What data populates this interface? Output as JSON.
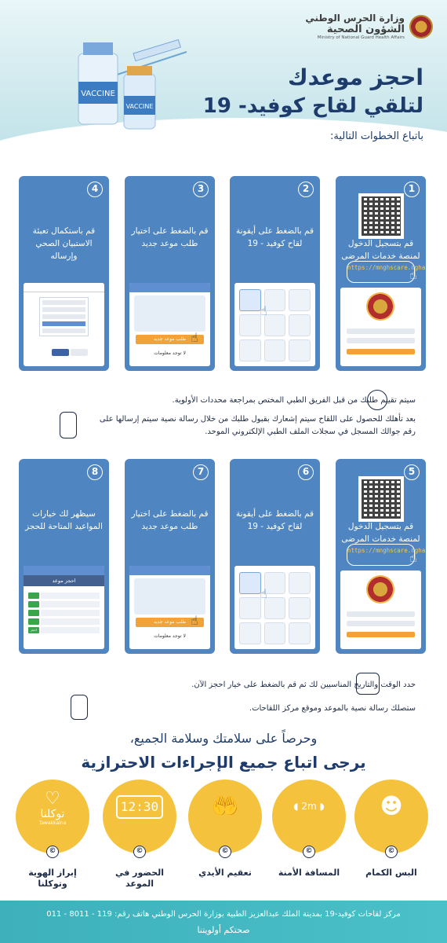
{
  "header": {
    "ministry_line1": "وزارة الحرس الوطني",
    "ministry_line2": "الشؤون الصحية",
    "ministry_en": "Ministry of National Guard Health Affairs",
    "title_line1": "احجز موعدك",
    "title_line2": "لتلقي لقاح كوفيد- 19",
    "steps_intro": "باتباع الخطوات التالية:",
    "vaccine_label_1": "VACCINE",
    "vaccine_label_2": "VACCINE"
  },
  "steps_top": [
    {
      "num": "1",
      "text": "قم بتسجيل الدخول لمنصة خدمات المرضى",
      "url": "https://mnghscare.ngha.med.sa/"
    },
    {
      "num": "2",
      "text": "قم بالضغط على أيقونة لقاح كوفيد - 19"
    },
    {
      "num": "3",
      "text": "قم بالضغط على اختيار طلب موعد جديد",
      "btn": "طلب موعد جديد",
      "link": "لا توجد معلومات"
    },
    {
      "num": "4",
      "text": "قم باستكمال تعبئة الاستبيان الصحي وإرساله"
    }
  ],
  "info_mid": [
    "سيتم تقييم طلبك من قبل الفريق الطبي المختص بمراجعة محددات الأولوية.",
    "بعد تأهلك للحصول على اللقاح سيتم إشعارك بقبول طلبك من خلال رسالة نصية سيتم إرسالها على رقم جوالك المسجل في سجلات الملف الطبي الإلكتروني الموحد."
  ],
  "steps_bottom": [
    {
      "num": "5",
      "text": "قم بتسجيل الدخول لمنصة خدمات المرضى",
      "url": "https://mnghscare.ngha.med.sa/"
    },
    {
      "num": "6",
      "text": "قم بالضغط على أيقونة لقاح كوفيد - 19"
    },
    {
      "num": "7",
      "text": "قم بالضغط على اختيار طلب موعد جديد",
      "btn": "طلب موعد جديد",
      "link": "لا توجد معلومات"
    },
    {
      "num": "8",
      "text": "سيظهر لك خيارات المواعيد المتاحة للحجز",
      "book_header": "احجز موعد",
      "book_btn": "احجز الآن"
    }
  ],
  "info_bottom": [
    "حدد الوقت والتاريخ المناسبين لك ثم قم بالضغط على خيار احجز الآن.",
    "ستصلك رسالة نصية بالموعد وموقع مركز اللقاحات."
  ],
  "closing": {
    "line1": "وحرصاً على سلامتك وسلامة الجميع،",
    "line2": "يرجى اتباع جميع الإجراءات الاحترازية"
  },
  "precautions": [
    {
      "label": "إبراز الهوية وتوكلنا",
      "icon_name": "tawakkalna-heart-icon",
      "icon_text": "توكلنا",
      "icon_sub": "Tawakkalna"
    },
    {
      "label": "الحضور في الموعد",
      "icon_name": "clock-icon",
      "icon_text": "12:30"
    },
    {
      "label": "تعقيم الأيدي",
      "icon_name": "hand-sanitize-icon"
    },
    {
      "label": "المسافة الأمنة",
      "icon_name": "distance-icon",
      "icon_text": "2m"
    },
    {
      "label": "البس الكمام",
      "icon_name": "mask-icon"
    }
  ],
  "footer": {
    "line1": "مركز لقاحات كوفيد-19 بمدينة الملك عبدالعزيز الطبية بوزارة الحرس الوطني هاتف رقم: 119 - 8011 - 011",
    "line2": "صحتكم أولويتنا"
  }
}
